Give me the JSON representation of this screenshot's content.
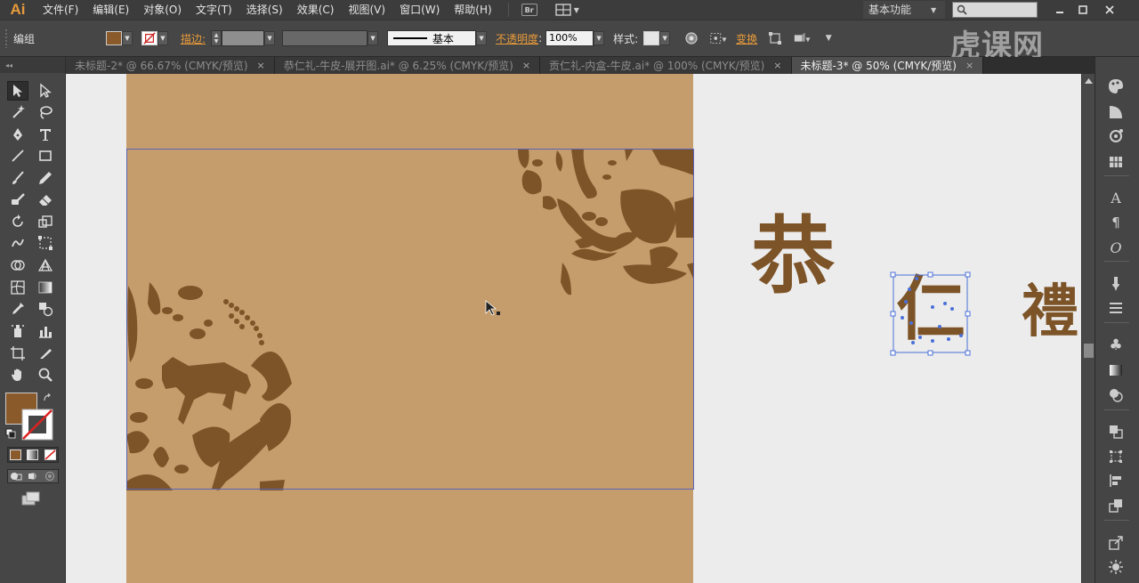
{
  "app": {
    "logo": "Ai"
  },
  "menu": [
    "文件(F)",
    "编辑(E)",
    "对象(O)",
    "文字(T)",
    "选择(S)",
    "效果(C)",
    "视图(V)",
    "窗口(W)",
    "帮助(H)"
  ],
  "bridge_label": "Br",
  "workspace": {
    "label": "基本功能",
    "search_placeholder": ""
  },
  "controlbar": {
    "selection_label": "编组",
    "fill_color": "#8a5a2b",
    "stroke_label": "描边:",
    "stroke_style_label": "基本",
    "opacity_label": "不透明度",
    "opacity_value": "100%",
    "style_label": "样式:",
    "transform_label": "变换"
  },
  "tabs": [
    {
      "label": "未标题-2* @ 66.67% (CMYK/预览)",
      "active": false
    },
    {
      "label": "恭仁礼-牛皮-展开图.ai* @ 6.25% (CMYK/预览)",
      "active": false
    },
    {
      "label": "贡仁礼-内盒-牛皮.ai* @ 100% (CMYK/预览)",
      "active": false
    },
    {
      "label": "未标题-3* @ 50% (CMYK/预览)",
      "active": true
    }
  ],
  "tab_close": "×",
  "canvas": {
    "artboard_color": "#c59c6b",
    "illustration_color": "#7d5428",
    "calligraphy": [
      "恭",
      "仁",
      "禮"
    ]
  },
  "watermark": "虎课网",
  "colors": {
    "accent_orange": "#e89b3b",
    "selection_blue": "#4a6fd8"
  }
}
